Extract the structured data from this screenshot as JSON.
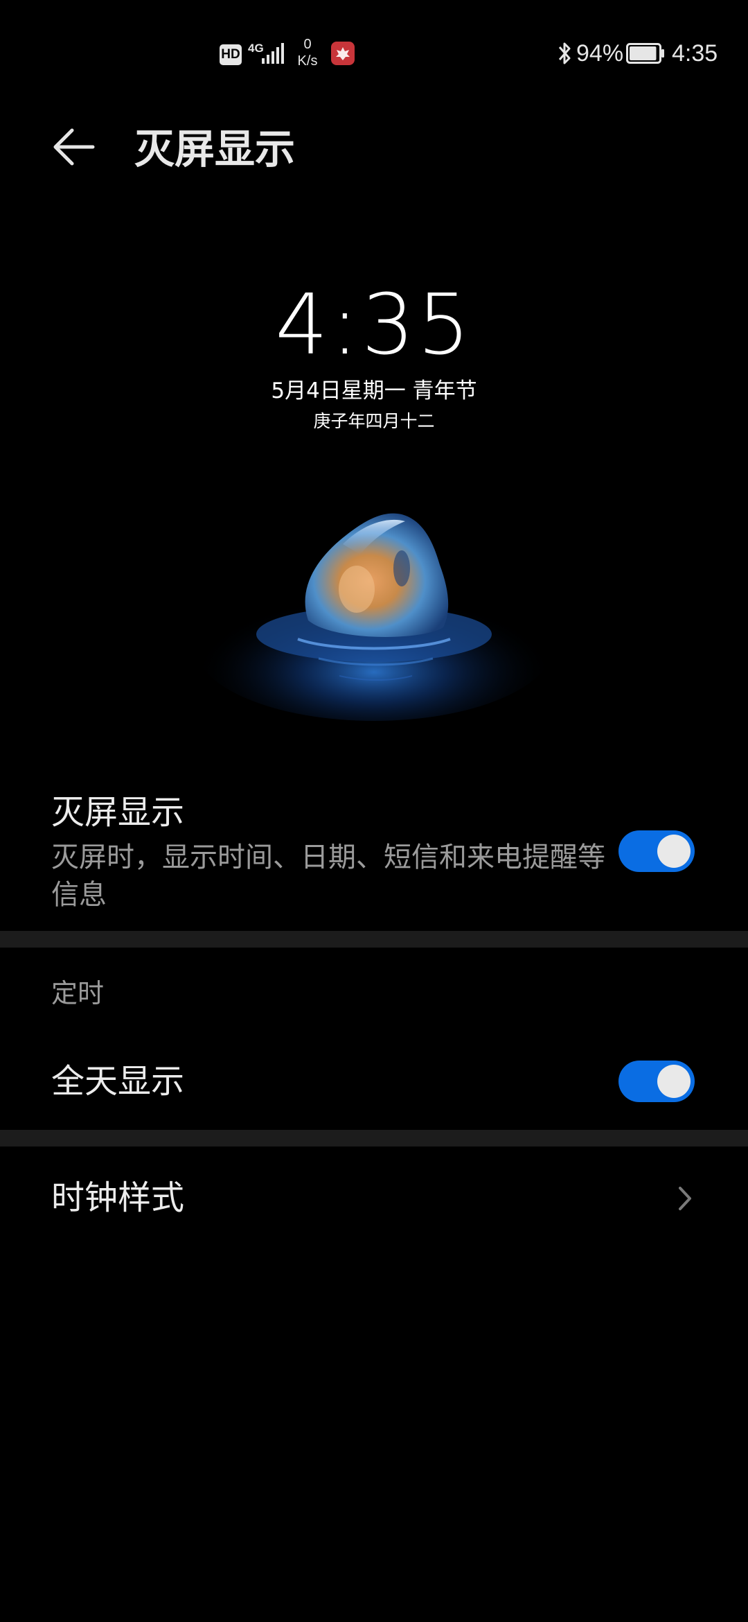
{
  "status_bar": {
    "hd_badge": "HD",
    "network_type": "4G",
    "speed_value": "0",
    "speed_unit": "K/s",
    "battery_percent": "94%",
    "battery_level": 0.94,
    "time": "4:35",
    "icons": [
      "hd-icon",
      "signal-icon",
      "app-notification-icon",
      "bluetooth-icon",
      "battery-icon"
    ]
  },
  "header": {
    "title": "灭屏显示",
    "back_icon": "arrow-left-icon"
  },
  "preview": {
    "time": "4:35",
    "date": "5月4日星期一  青年节",
    "lunar_date": "庚子年四月十二"
  },
  "settings": {
    "aod": {
      "title": "灭屏显示",
      "description": "灭屏时，显示时间、日期、短信和来电提醒等信息",
      "enabled": true
    },
    "schedule_section": "定时",
    "all_day": {
      "label": "全天显示",
      "enabled": true
    },
    "clock_style": {
      "label": "时钟样式",
      "icon": "chevron-right-icon"
    }
  },
  "colors": {
    "background": "#000000",
    "toggle_on": "#0a6de3",
    "divider": "#1c1c1c",
    "secondary_text": "#9b9b9b"
  }
}
